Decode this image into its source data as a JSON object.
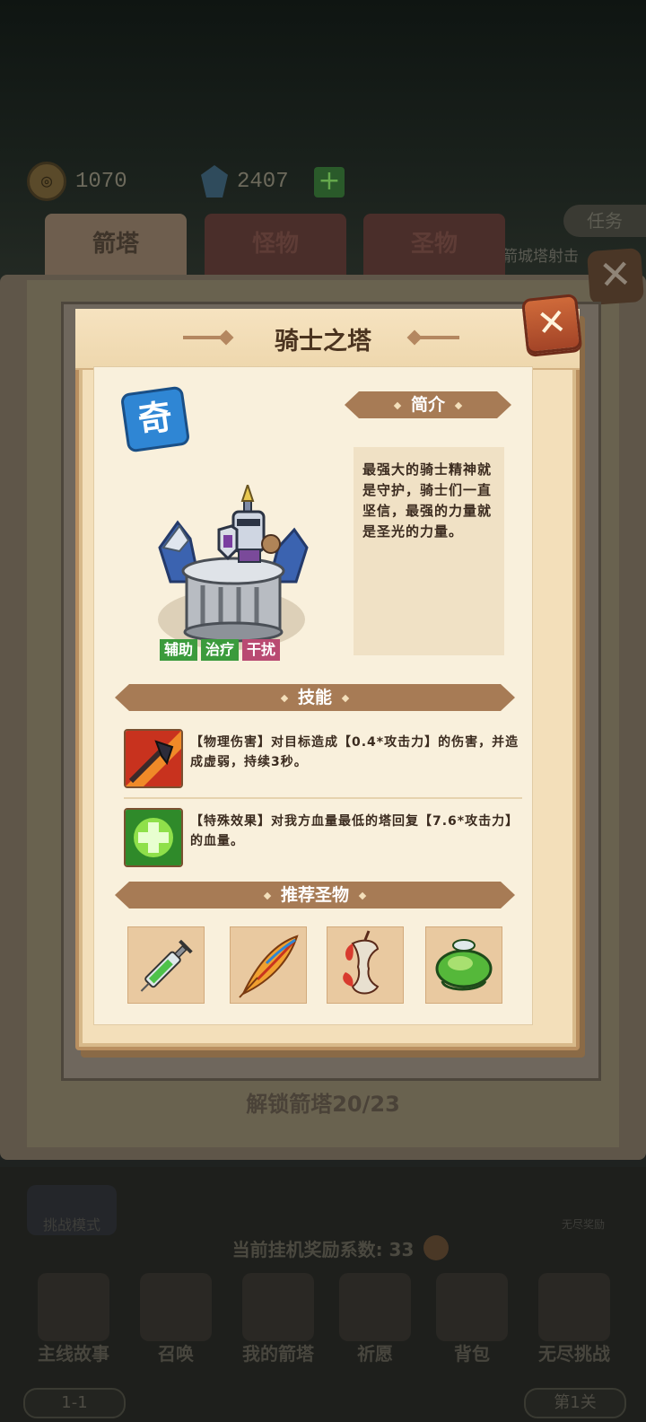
{
  "resources": {
    "gold": "1070",
    "gems": "2407",
    "add": "+"
  },
  "side": {
    "task": "任务",
    "strip": "箭城塔射击"
  },
  "tabs": [
    "箭塔",
    "怪物",
    "圣物"
  ],
  "outer_close": "✕",
  "dialog": {
    "title": "骑士之塔",
    "close": "✕",
    "rarity_badge": "奇",
    "intro_header": "简介",
    "intro_text": "最强大的骑士精神就是守护，骑士们一直坚信，最强的力量就是圣光的力量。",
    "tags": [
      "辅助",
      "治疗",
      "干扰"
    ],
    "skills_header": "技能",
    "skills": [
      {
        "icon": "axe-fire-icon",
        "text": "【物理伤害】对目标造成【0.4*攻击力】的伤害，并造成虚弱，持续3秒。"
      },
      {
        "icon": "heal-cross-icon",
        "text": "【特殊效果】对我方血量最低的塔回复【7.6*攻击力】的血量。"
      }
    ],
    "relics_header": "推荐圣物",
    "relics": [
      "syringe-icon",
      "feather-icon",
      "apple-core-icon",
      "green-ring-icon"
    ]
  },
  "unlock_text": "解锁箭塔20/23",
  "bottom": {
    "mode": "挑战模式",
    "endless_reward": "无尽奖励",
    "idle_ratio": "当前挂机奖励系数:  33",
    "nav": [
      "主线故事",
      "召唤",
      "我的箭塔",
      "祈愿",
      "背包",
      "无尽挑战"
    ],
    "level_left": "1-1",
    "level_right": "第1关"
  },
  "colors": {
    "accent": "#a77b55",
    "close": "#c45a32",
    "parchment": "#f3dfba",
    "tag_green": "#3b9b3c",
    "tag_pink": "#b94a72",
    "badge_blue": "#2f86d4"
  }
}
